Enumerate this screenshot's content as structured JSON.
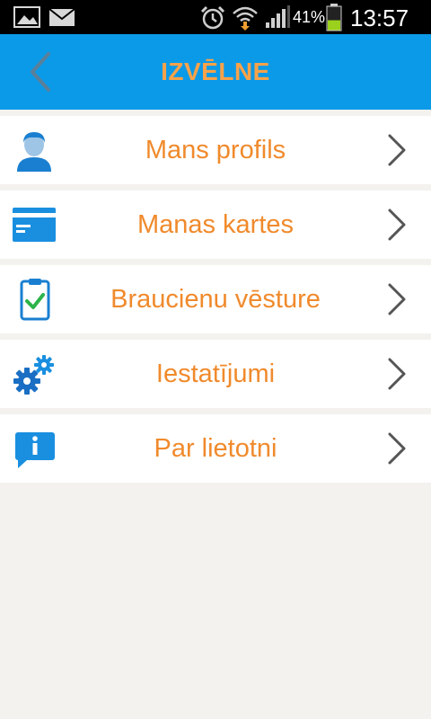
{
  "status_bar": {
    "battery_percent": "41%",
    "time": "13:57",
    "battery_level": 0.41,
    "icons": [
      "image-icon",
      "mail-icon",
      "alarm-icon",
      "wifi-icon",
      "signal-icon",
      "battery-icon"
    ]
  },
  "header": {
    "title": "IZVĒLNE",
    "back_icon": "chevron-left-icon"
  },
  "colors": {
    "accent_blue": "#0b9ae8",
    "label_orange": "#f08a2c",
    "title_orange": "#f7a24a",
    "background": "#f3f2ee",
    "check_green": "#2db34a",
    "chevron_gray": "#555555"
  },
  "menu": {
    "items": [
      {
        "label": "Mans profils",
        "icon": "user-profile-icon"
      },
      {
        "label": "Manas kartes",
        "icon": "credit-card-icon"
      },
      {
        "label": "Braucienu vēsture",
        "icon": "clipboard-check-icon"
      },
      {
        "label": "Iestatījumi",
        "icon": "gears-icon"
      },
      {
        "label": "Par lietotni",
        "icon": "info-bubble-icon"
      }
    ]
  }
}
